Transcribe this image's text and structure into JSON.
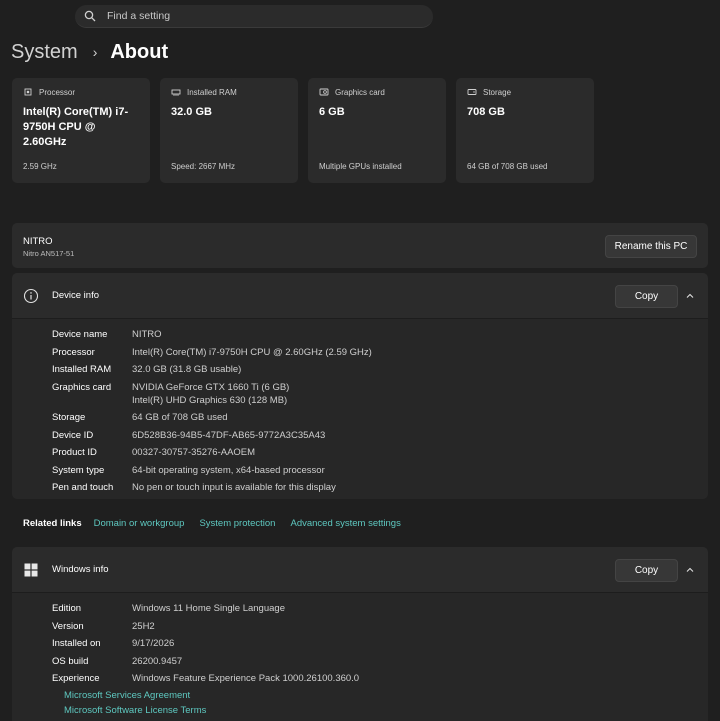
{
  "search": {
    "placeholder": "Find a setting"
  },
  "breadcrumb": {
    "parent": "System",
    "current": "About"
  },
  "cards": [
    {
      "label": "Processor",
      "value": "Intel(R) Core(TM) i7-9750H CPU @ 2.60GHz",
      "sub": "2.59 GHz",
      "icon": "processor-icon"
    },
    {
      "label": "Installed RAM",
      "value": "32.0 GB",
      "sub": "Speed: 2667 MHz",
      "icon": "ram-icon"
    },
    {
      "label": "Graphics card",
      "value": "6 GB",
      "sub": "Multiple GPUs installed",
      "icon": "graphics-card-icon"
    },
    {
      "label": "Storage",
      "value": "708 GB",
      "sub": "64 GB of 708 GB used",
      "icon": "storage-icon"
    }
  ],
  "pc": {
    "name": "NITRO",
    "model": "Nitro AN517-51",
    "rename_label": "Rename this PC"
  },
  "device_info": {
    "title": "Device info",
    "copy_label": "Copy",
    "rows": [
      {
        "key": "Device name",
        "value": "NITRO"
      },
      {
        "key": "Processor",
        "value": "Intel(R) Core(TM) i7-9750H CPU @ 2.60GHz (2.59 GHz)"
      },
      {
        "key": "Installed RAM",
        "value": "32.0 GB (31.8 GB usable)"
      },
      {
        "key": "Graphics card",
        "value": "NVIDIA GeForce GTX 1660 Ti (6 GB)",
        "value2": "Intel(R) UHD Graphics 630 (128 MB)"
      },
      {
        "key": "Storage",
        "value": "64 GB of 708 GB used"
      },
      {
        "key": "Device ID",
        "value": "6D528B36-94B5-47DF-AB65-9772A3C35A43"
      },
      {
        "key": "Product ID",
        "value": "00327-30757-35276-AAOEM"
      },
      {
        "key": "System type",
        "value": "64-bit operating system, x64-based processor"
      },
      {
        "key": "Pen and touch",
        "value": "No pen or touch input is available for this display"
      }
    ]
  },
  "related": {
    "label": "Related links",
    "links": [
      "Domain or workgroup",
      "System protection",
      "Advanced system settings"
    ]
  },
  "windows_info": {
    "title": "Windows info",
    "copy_label": "Copy",
    "rows": [
      {
        "key": "Edition",
        "value": "Windows 11 Home Single Language"
      },
      {
        "key": "Version",
        "value": "25H2"
      },
      {
        "key": "Installed on",
        "value": "9/17/2026"
      },
      {
        "key": "OS build",
        "value": "26200.9457"
      },
      {
        "key": "Experience",
        "value": "Windows Feature Experience Pack 1000.26100.360.0"
      }
    ],
    "links": [
      "Microsoft Services Agreement",
      "Microsoft Software License Terms"
    ]
  },
  "colors": {
    "accent_link": "#5ec8c0",
    "background": "#1f1f1f",
    "card": "#2b2b2b"
  }
}
